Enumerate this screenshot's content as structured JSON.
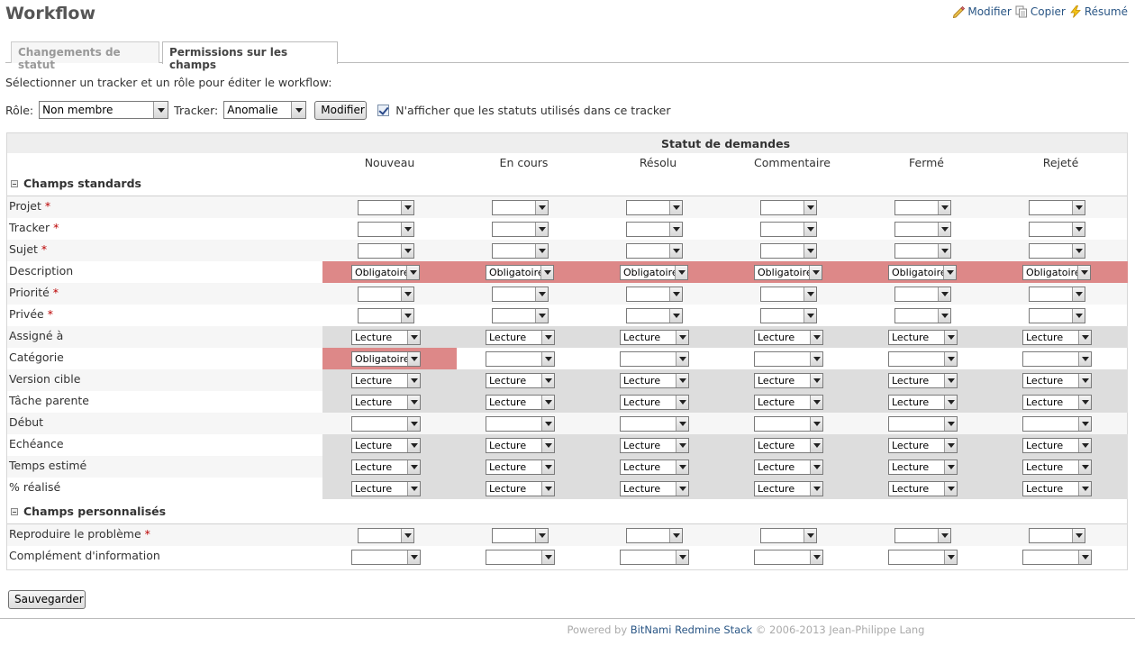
{
  "page": {
    "title": "Workflow"
  },
  "contextual": {
    "edit_label": "Modifier",
    "copy_label": "Copier",
    "summary_label": "Résumé"
  },
  "tabs": [
    {
      "label": "Changements de statut",
      "active": false
    },
    {
      "label": "Permissions sur les champs",
      "active": true
    }
  ],
  "intro_text": "Sélectionner un tracker et un rôle pour éditer le workflow:",
  "filters": {
    "role_label": "Rôle:",
    "role_value": "Non membre",
    "tracker_label": "Tracker:",
    "tracker_value": "Anomalie",
    "submit_label": "Modifier",
    "used_statuses_only_label": "N'afficher que les statuts utilisés dans ce tracker",
    "used_statuses_only_checked": true
  },
  "table": {
    "header": "Statut de demandes",
    "statuses": [
      "Nouveau",
      "En cours",
      "Résolu",
      "Commentaire",
      "Fermé",
      "Rejeté"
    ],
    "required_marker": "*",
    "groups": [
      {
        "title": "Champs standards",
        "rows": [
          {
            "label": "Projet",
            "required": true,
            "cells": [
              "",
              "",
              "",
              "",
              "",
              ""
            ]
          },
          {
            "label": "Tracker",
            "required": true,
            "cells": [
              "",
              "",
              "",
              "",
              "",
              ""
            ]
          },
          {
            "label": "Sujet",
            "required": true,
            "cells": [
              "",
              "",
              "",
              "",
              "",
              ""
            ]
          },
          {
            "label": "Description",
            "required": false,
            "cells": [
              "Obligatoire",
              "Obligatoire",
              "Obligatoire",
              "Obligatoire",
              "Obligatoire",
              "Obligatoire"
            ]
          },
          {
            "label": "Priorité",
            "required": true,
            "cells": [
              "",
              "",
              "",
              "",
              "",
              ""
            ]
          },
          {
            "label": "Privée",
            "required": true,
            "cells": [
              "",
              "",
              "",
              "",
              "",
              ""
            ]
          },
          {
            "label": "Assigné à",
            "required": false,
            "cells": [
              "Lecture",
              "Lecture",
              "Lecture",
              "Lecture",
              "Lecture",
              "Lecture"
            ]
          },
          {
            "label": "Catégorie",
            "required": false,
            "cells": [
              "Obligatoire",
              "",
              "",
              "",
              "",
              ""
            ]
          },
          {
            "label": "Version cible",
            "required": false,
            "cells": [
              "Lecture",
              "Lecture",
              "Lecture",
              "Lecture",
              "Lecture",
              "Lecture"
            ]
          },
          {
            "label": "Tâche parente",
            "required": false,
            "cells": [
              "Lecture",
              "Lecture",
              "Lecture",
              "Lecture",
              "Lecture",
              "Lecture"
            ]
          },
          {
            "label": "Début",
            "required": false,
            "cells": [
              "",
              "",
              "",
              "",
              "",
              ""
            ]
          },
          {
            "label": "Echéance",
            "required": false,
            "cells": [
              "Lecture",
              "Lecture",
              "Lecture",
              "Lecture",
              "Lecture",
              "Lecture"
            ]
          },
          {
            "label": "Temps estimé",
            "required": false,
            "cells": [
              "Lecture",
              "Lecture",
              "Lecture",
              "Lecture",
              "Lecture",
              "Lecture"
            ]
          },
          {
            "label": "% réalisé",
            "required": false,
            "cells": [
              "Lecture",
              "Lecture",
              "Lecture",
              "Lecture",
              "Lecture",
              "Lecture"
            ]
          }
        ]
      },
      {
        "title": "Champs personnalisés",
        "rows": [
          {
            "label": "Reproduire le problème",
            "required": true,
            "cells": [
              "",
              "",
              "",
              "",
              "",
              ""
            ]
          },
          {
            "label": "Complément d'information",
            "required": false,
            "cells": [
              "",
              "",
              "",
              "",
              "",
              ""
            ]
          }
        ]
      }
    ]
  },
  "save_label": "Sauvegarder",
  "footer": {
    "prefix": "Powered by",
    "link": "BitNami Redmine Stack",
    "suffix": "© 2006-2013 Jean-Philippe Lang"
  },
  "colors": {
    "link": "#2A5685",
    "readonly_cell": "#dddddd",
    "required_cell": "#dd8888",
    "required_marker": "#bb0000"
  }
}
